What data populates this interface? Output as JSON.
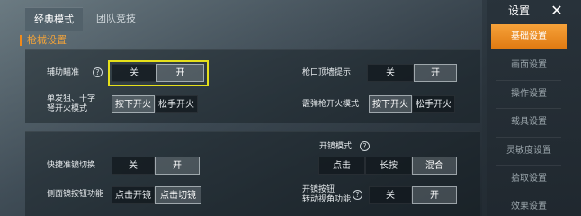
{
  "tabs": [
    {
      "label": "经典模式",
      "active": true
    },
    {
      "label": "团队竞技",
      "active": false
    }
  ],
  "section": {
    "title": "枪械设置"
  },
  "settings": {
    "aim_assist": {
      "label": "辅助瞄准",
      "help": "?",
      "options": [
        "关",
        "开"
      ],
      "selected": "开"
    },
    "muzzle_hint": {
      "label": "枪口顶墙提示",
      "options": [
        "关",
        "开"
      ],
      "selected": "开"
    },
    "single_fire": {
      "label_line1": "单发狙、十字",
      "label_line2": "弩开火模式",
      "options": [
        "按下开火",
        "松手开火"
      ],
      "selected": "按下开火"
    },
    "shotgun_fire": {
      "label": "霰弹枪开火模式",
      "options": [
        "按下开火",
        "松手开火"
      ],
      "selected": "按下开火"
    },
    "scope_mode": {
      "label": "开镜模式",
      "help": "?",
      "options": [
        "点击",
        "长按",
        "混合"
      ],
      "selected": "混合"
    },
    "quick_scope": {
      "label": "快捷准镜切换",
      "options": [
        "关",
        "开"
      ],
      "selected": "开"
    },
    "side_scope_btn": {
      "label": "侧面镜按钮功能",
      "options": [
        "点击开镜",
        "点击切镜"
      ],
      "selected": "点击切镜"
    },
    "scope_btn_turn": {
      "label_line1": "开镜按钮",
      "label_line2": "转动视角功能",
      "help": "?",
      "options": [
        "关",
        "开"
      ],
      "selected": "开"
    }
  },
  "sidebar": {
    "title": "设置",
    "close": "✕",
    "items": [
      {
        "label": "基础设置",
        "active": true
      },
      {
        "label": "画面设置",
        "active": false
      },
      {
        "label": "操作设置",
        "active": false
      },
      {
        "label": "载具设置",
        "active": false
      },
      {
        "label": "灵敏度设置",
        "active": false
      },
      {
        "label": "拾取设置",
        "active": false
      },
      {
        "label": "效果设置",
        "active": false
      }
    ]
  },
  "colors": {
    "accent": "#f28a1a",
    "highlight": "#e6e01a"
  }
}
